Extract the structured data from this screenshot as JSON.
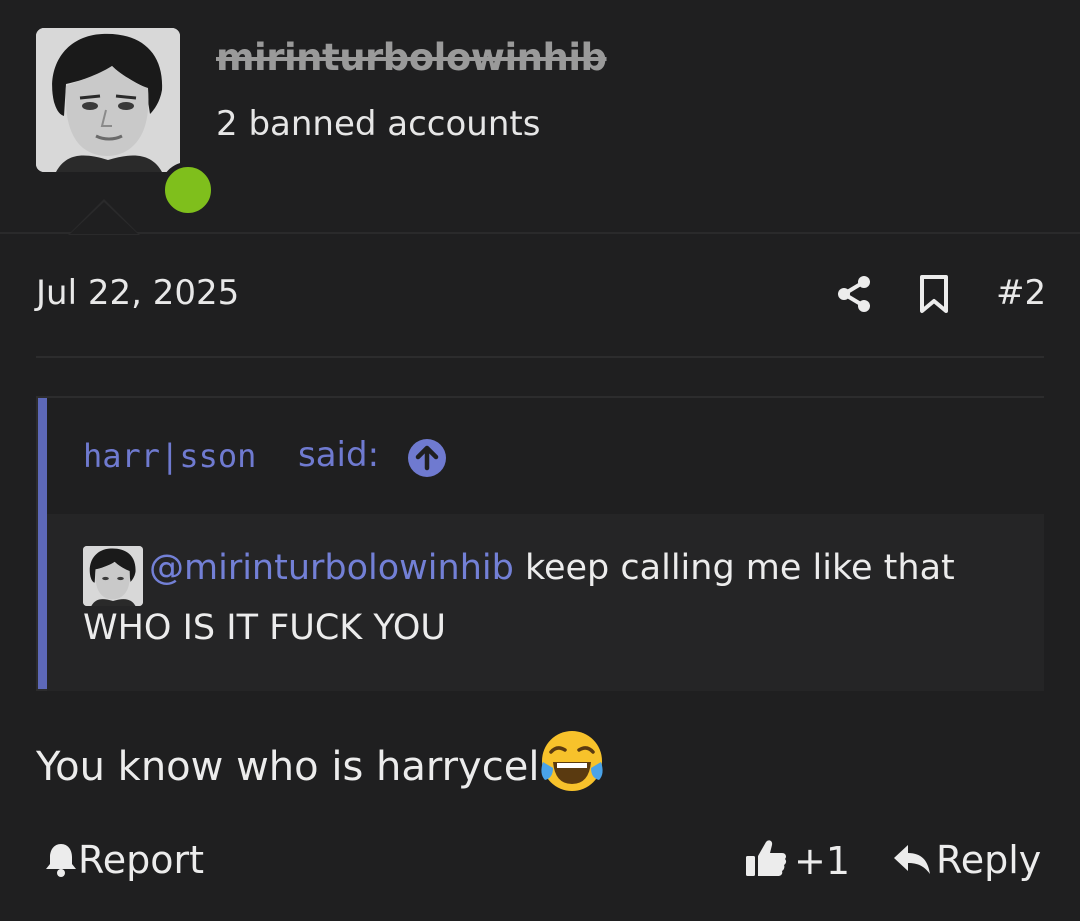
{
  "user": {
    "username": "mirinturbolowinhib",
    "title": "2 banned accounts",
    "status_color": "#7fbf1c"
  },
  "post": {
    "date": "Jul 22, 2025",
    "number": "#2",
    "share_icon": "share-icon",
    "bookmark_icon": "bookmark-icon"
  },
  "quote": {
    "author": "harr|sson",
    "said": "said:",
    "mention": "@mirinturbolowinhib",
    "line1_rest": " keep calling me like that",
    "line2": "WHO IS IT FUCK YOU",
    "accent": "#5d68b8"
  },
  "body": {
    "text": "You know who is harrycel",
    "emoji": "face-with-tears-of-joy"
  },
  "actions": {
    "report": "Report",
    "like_count": "+1",
    "reply": "Reply"
  }
}
